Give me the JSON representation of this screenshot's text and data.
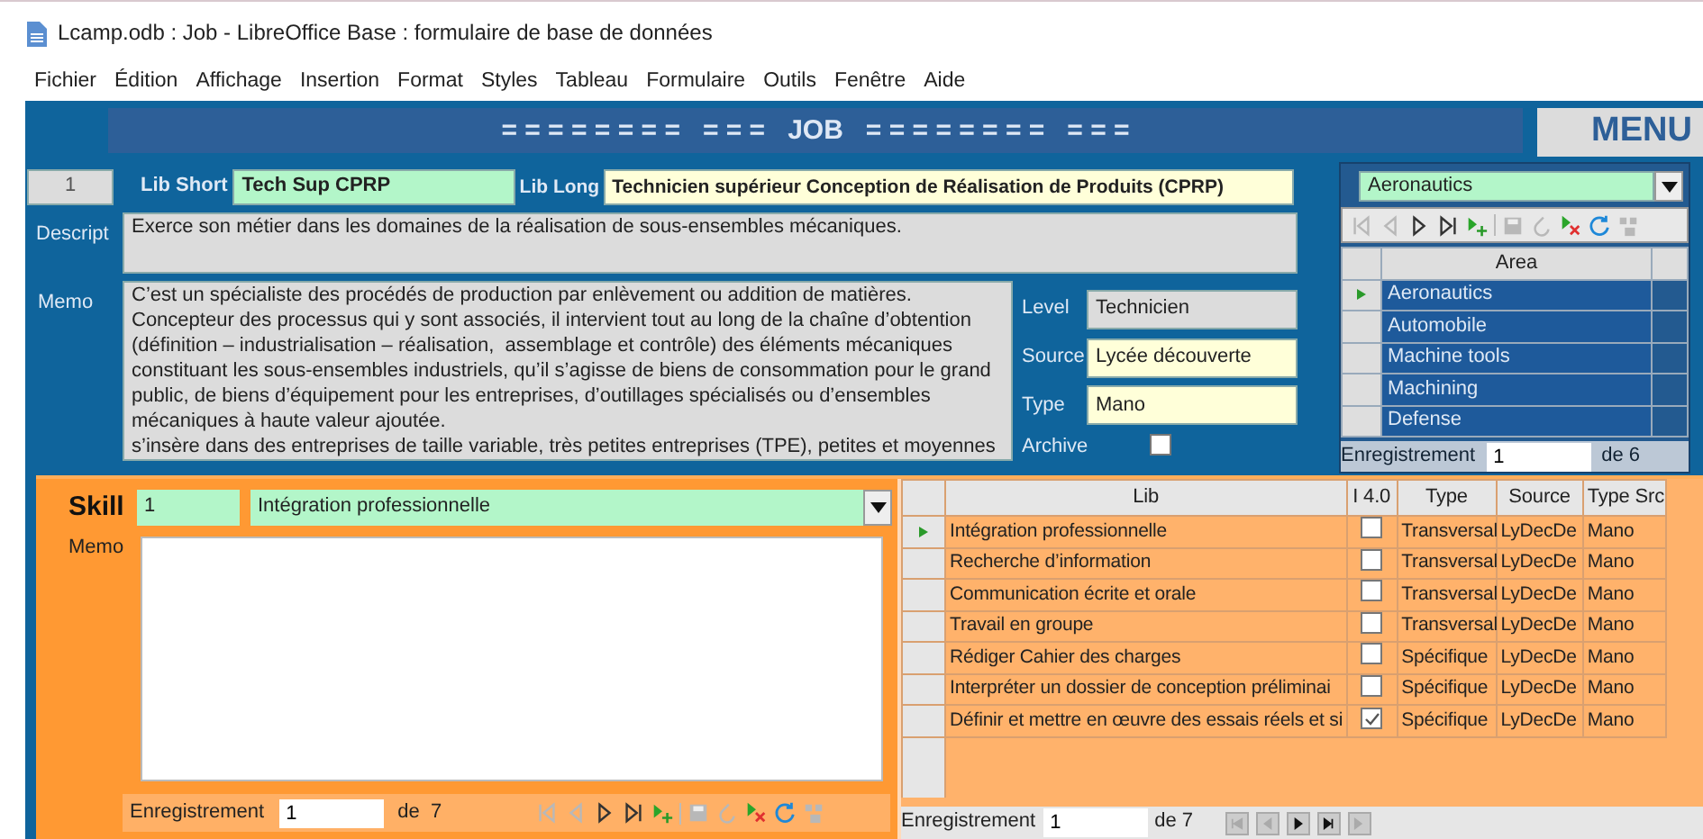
{
  "window": {
    "title": "Lcamp.odb : Job - LibreOffice Base : formulaire de base de données"
  },
  "menu": [
    {
      "label": "Fichier"
    },
    {
      "label": "Édition"
    },
    {
      "label": "Affichage"
    },
    {
      "label": "Insertion"
    },
    {
      "label": "Format"
    },
    {
      "label": "Styles"
    },
    {
      "label": "Tableau"
    },
    {
      "label": "Formulaire"
    },
    {
      "label": "Outils"
    },
    {
      "label": "Fenêtre"
    },
    {
      "label": "Aide"
    }
  ],
  "header": {
    "title": "= = = = = = = =   = = =   JOB   = = = = = = = =   = = =",
    "menu_button": "MENU"
  },
  "job": {
    "id": "1",
    "lib_short_label": "Lib Short",
    "lib_short": "Tech Sup CPRP",
    "lib_long_label": "Lib Long",
    "lib_long": "Technicien supérieur Conception de Réalisation de Produits (CPRP)",
    "descript_label": "Descript",
    "descript": "Exerce son métier dans les domaines de la réalisation de sous-ensembles mécaniques.",
    "memo_label": "Memo",
    "memo": "C’est un spécialiste des procédés de production par enlèvement ou addition de matières.\nConcepteur des processus qui y sont associés, il intervient tout au long de la chaîne d’obtention (définition – industrialisation – réalisation,  assemblage et contrôle) des éléments mécaniques constituant les sous-ensembles industriels, qu’il s’agisse de biens de consommation pour le grand public, de biens d’équipement pour les entreprises, d’outillages spécialisés ou d’ensembles mécaniques à haute valeur ajoutée.\ns’insère dans des entreprises de taille variable, très petites entreprises (TPE), petites et moyennes",
    "level_label": "Level",
    "level": "Technicien",
    "source_label": "Source",
    "source": "Lycée découverte",
    "type_label": "Type",
    "type": "Mano",
    "archive_label": "Archive",
    "archive": false
  },
  "area": {
    "combo": "Aeronautics",
    "tools": [
      {
        "kind": "first",
        "disabled": true
      },
      {
        "kind": "prev",
        "disabled": true
      },
      {
        "kind": "next",
        "disabled": false
      },
      {
        "kind": "last",
        "disabled": false
      },
      {
        "kind": "new",
        "disabled": false
      },
      {
        "kind": "save",
        "disabled": true
      },
      {
        "kind": "undo",
        "disabled": true
      },
      {
        "kind": "delete",
        "disabled": false
      },
      {
        "kind": "refresh",
        "disabled": false
      },
      {
        "kind": "filter",
        "disabled": true
      }
    ],
    "column": "Area",
    "rows": [
      {
        "name": "Aeronautics",
        "current": true
      },
      {
        "name": "Automobile",
        "current": false
      },
      {
        "name": "Machine tools",
        "current": false
      },
      {
        "name": "Machining",
        "current": false
      },
      {
        "name": "Defense",
        "current": false
      }
    ],
    "record_label": "Enregistrement",
    "record": "1",
    "record_of": "de 6"
  },
  "skill": {
    "label": "Skill",
    "id": "1",
    "name": "Intégration professionnelle",
    "memo_label": "Memo",
    "record_label": "Enregistrement",
    "record": "1",
    "record_of": "de  7",
    "tools": [
      {
        "kind": "first",
        "disabled": true
      },
      {
        "kind": "prev",
        "disabled": true
      },
      {
        "kind": "next",
        "disabled": false
      },
      {
        "kind": "last",
        "disabled": false
      },
      {
        "kind": "new",
        "disabled": false
      },
      {
        "kind": "save",
        "disabled": true
      },
      {
        "kind": "undo",
        "disabled": true
      },
      {
        "kind": "delete",
        "disabled": false
      },
      {
        "kind": "refresh",
        "disabled": false
      },
      {
        "kind": "filter",
        "disabled": true
      }
    ]
  },
  "skills_table": {
    "columns": [
      "Lib",
      "I 4.0",
      "Type",
      "Source",
      "Type Src"
    ],
    "rows": [
      {
        "lib": "Intégration professionnelle",
        "i40": false,
        "type": "Transversal",
        "source": "LyDecDe",
        "type_src": "Mano",
        "current": true
      },
      {
        "lib": "Recherche d’information",
        "i40": false,
        "type": "Transversal",
        "source": "LyDecDe",
        "type_src": "Mano",
        "current": false
      },
      {
        "lib": "Communication écrite et orale",
        "i40": false,
        "type": "Transversal",
        "source": "LyDecDe",
        "type_src": "Mano",
        "current": false
      },
      {
        "lib": "Travail en groupe",
        "i40": false,
        "type": "Transversal",
        "source": "LyDecDe",
        "type_src": "Mano",
        "current": false
      },
      {
        "lib": "Rédiger Cahier des charges",
        "i40": false,
        "type": "Spécifique",
        "source": "LyDecDe",
        "type_src": "Mano",
        "current": false
      },
      {
        "lib": "Interpréter un dossier de conception préliminai",
        "i40": false,
        "type": "Spécifique",
        "source": "LyDecDe",
        "type_src": "Mano",
        "current": false
      },
      {
        "lib": "Définir et mettre en œuvre des essais réels et si",
        "i40": true,
        "type": "Spécifique",
        "source": "LyDecDe",
        "type_src": "Mano",
        "current": false
      }
    ],
    "record_label": "Enregistrement",
    "record": "1",
    "record_of": "de 7",
    "tools": [
      {
        "kind": "first",
        "disabled": true
      },
      {
        "kind": "prev",
        "disabled": true
      },
      {
        "kind": "next",
        "disabled": false
      },
      {
        "kind": "last",
        "disabled": false
      },
      {
        "kind": "new",
        "disabled": true
      }
    ]
  }
}
